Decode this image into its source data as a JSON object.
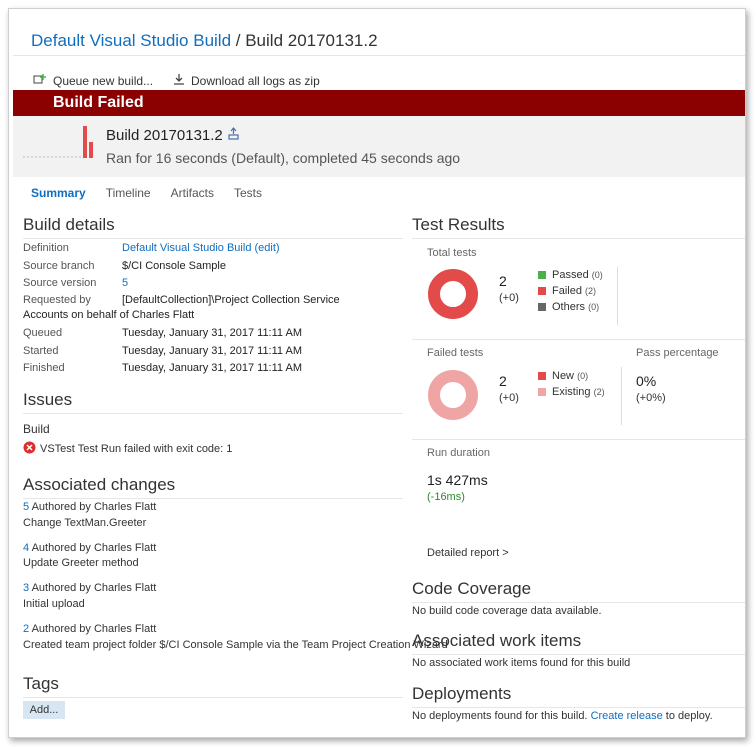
{
  "header": {
    "definition": "Default Visual Studio Build",
    "separator": " / ",
    "build": "Build 20170131.2"
  },
  "toolbar": {
    "queue_label": "Queue new build...",
    "download_label": "Download all logs as zip"
  },
  "banner": {
    "status": "Build Failed"
  },
  "summary": {
    "build_name": "Build 20170131.2",
    "ran_for": "Ran for 16 seconds (Default), completed 45 seconds ago"
  },
  "tabs": [
    {
      "label": "Summary",
      "active": true
    },
    {
      "label": "Timeline"
    },
    {
      "label": "Artifacts"
    },
    {
      "label": "Tests"
    }
  ],
  "build_details": {
    "title": "Build details",
    "definition_label": "Definition",
    "definition_value": "Default Visual Studio Build (edit)",
    "source_branch_label": "Source branch",
    "source_branch_value": "$/CI Console Sample",
    "source_version_label": "Source version",
    "source_version_value": "5",
    "requested_by_label": "Requested by",
    "requested_by_value": "[DefaultCollection]\\Project Collection Service",
    "requested_by_cont": "Accounts on behalf of Charles Flatt",
    "queued_label": "Queued",
    "queued_value": "Tuesday, January 31, 2017 11:11 AM",
    "started_label": "Started",
    "started_value": "Tuesday, January 31, 2017 11:11 AM",
    "finished_label": "Finished",
    "finished_value": "Tuesday, January 31, 2017 11:11 AM"
  },
  "issues": {
    "title": "Issues",
    "group": "Build",
    "error": "VSTest Test Run failed with exit code: 1"
  },
  "changes": {
    "title": "Associated changes",
    "items": [
      {
        "id": "5",
        "author": "Authored by Charles Flatt",
        "message": "Change TextMan.Greeter"
      },
      {
        "id": "4",
        "author": "Authored by Charles Flatt",
        "message": "Update Greeter method"
      },
      {
        "id": "3",
        "author": "Authored by Charles Flatt",
        "message": "Initial upload"
      },
      {
        "id": "2",
        "author": "Authored by Charles Flatt",
        "message": "Created team project folder $/CI Console Sample via the Team Project Creation Wizard"
      }
    ]
  },
  "tags": {
    "title": "Tags",
    "add_label": "Add..."
  },
  "test_results": {
    "title": "Test Results",
    "total_label": "Total tests",
    "total_count": "2",
    "total_delta": "(+0)",
    "passed_label": "Passed",
    "passed_count": "(0)",
    "failed_label": "Failed",
    "failed_count": "(2)",
    "others_label": "Others",
    "others_count": "(0)",
    "failed_tests_label": "Failed tests",
    "failed_tests_count": "2",
    "failed_tests_delta": "(+0)",
    "new_label": "New",
    "new_count": "(0)",
    "existing_label": "Existing",
    "existing_count": "(2)",
    "pass_pct_label": "Pass percentage",
    "pass_pct_value": "0%",
    "pass_pct_delta": "(+0%)",
    "run_duration_label": "Run duration",
    "run_duration_value": "1s 427ms",
    "run_duration_delta": "(-16ms)",
    "detailed_report": "Detailed report >"
  },
  "code_coverage": {
    "title": "Code Coverage",
    "message": "No build code coverage data available."
  },
  "work_items": {
    "title": "Associated work items",
    "message": "No associated work items found for this build"
  },
  "deployments": {
    "title": "Deployments",
    "message": "No deployments found for this build.",
    "create_link": "Create release",
    "suffix": "to deploy."
  },
  "colors": {
    "banner": "#8b0000",
    "failed": "#e34b4b",
    "passed": "#4cb050",
    "others": "#666666",
    "existing": "#f0a5a5",
    "link": "#106ebe",
    "positive": "#2a8a2a"
  }
}
